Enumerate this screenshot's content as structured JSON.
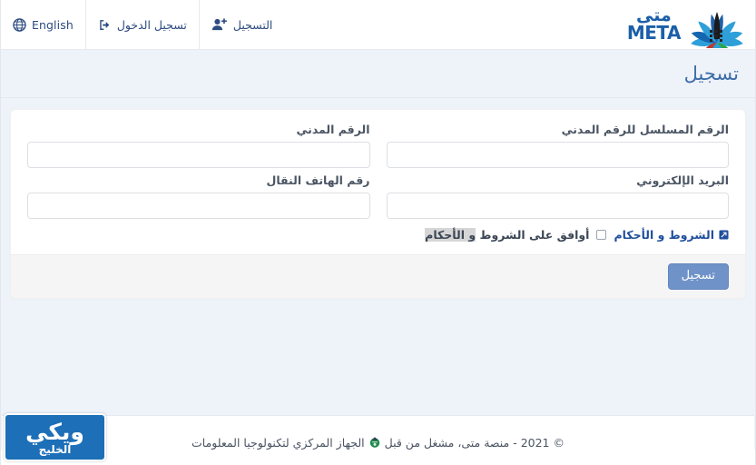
{
  "navbar": {
    "items": [
      {
        "label": "التسجيل",
        "icon": "user-plus-icon"
      },
      {
        "label": "تسجيل الدخول",
        "icon": "sign-in-icon"
      },
      {
        "label": "English",
        "icon": "globe-icon"
      }
    ],
    "brand": {
      "arabic": "متى",
      "english": "META",
      "mark": "meta-fan-logo"
    }
  },
  "header": {
    "title": "تسجيل"
  },
  "form": {
    "rows": [
      {
        "right": {
          "label": "الرقم المدني",
          "value": "",
          "placeholder": ""
        },
        "left": {
          "label": "الرقم المسلسل للرقم المدني",
          "value": "",
          "placeholder": ""
        }
      },
      {
        "right": {
          "label": "رقم الهاتف النقال",
          "value": "",
          "placeholder": ""
        },
        "left": {
          "label": "البريد الإلكتروني",
          "value": "",
          "placeholder": ""
        }
      }
    ],
    "terms": {
      "link_label": "الشروط و الأحكام",
      "link_icon": "external-link-icon",
      "checkbox_checked": false,
      "agree_text_plain": "أوافق على الشروط ",
      "agree_text_highlight": "و الأحكام"
    },
    "submit_label": "تسجيل"
  },
  "footer": {
    "copyright": "© 2021 - منصة متى، مشغل من قبل",
    "organization": "الجهاز المركزي لتكنولوجيا المعلومات",
    "icon": "cait-emblem-icon"
  },
  "watermark": {
    "main": "ويكي",
    "sub": "الخليج"
  },
  "colors": {
    "brand_blue": "#1b5fa8",
    "nav_text": "#2c4b80",
    "page_band": "#eef2f9",
    "title_blue": "#3d6ea8",
    "button_blue": "#6f93c9",
    "link_blue": "#1f4e9c",
    "watermark_blue": "#1d6fb8"
  }
}
